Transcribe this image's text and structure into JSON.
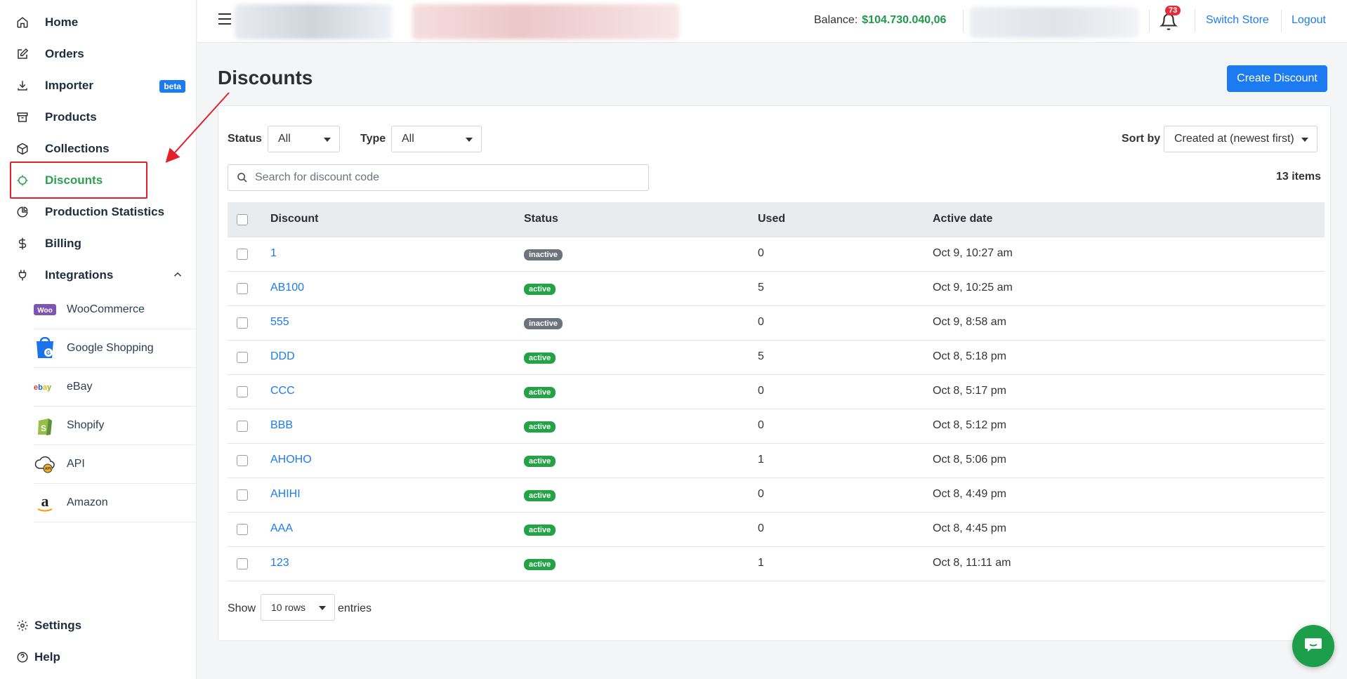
{
  "sidebar": {
    "items": [
      {
        "label": "Home",
        "icon": "home-icon"
      },
      {
        "label": "Orders",
        "icon": "edit-icon"
      },
      {
        "label": "Importer",
        "icon": "download-icon",
        "badge": "beta"
      },
      {
        "label": "Products",
        "icon": "archive-icon"
      },
      {
        "label": "Collections",
        "icon": "box-icon"
      },
      {
        "label": "Discounts",
        "icon": "crosshair-icon",
        "active": true
      },
      {
        "label": "Production Statistics",
        "icon": "pie-chart-icon"
      },
      {
        "label": "Billing",
        "icon": "dollar-icon"
      },
      {
        "label": "Integrations",
        "icon": "plug-icon",
        "expanded": true
      }
    ],
    "integrations": [
      {
        "label": "WooCommerce",
        "icon": "woocommerce-icon"
      },
      {
        "label": "Google Shopping",
        "icon": "google-shopping-icon"
      },
      {
        "label": "eBay",
        "icon": "ebay-icon"
      },
      {
        "label": "Shopify",
        "icon": "shopify-icon"
      },
      {
        "label": "API",
        "icon": "api-icon"
      },
      {
        "label": "Amazon",
        "icon": "amazon-icon"
      }
    ],
    "footer": [
      {
        "label": "Settings",
        "icon": "gear-icon"
      },
      {
        "label": "Help",
        "icon": "help-icon"
      }
    ]
  },
  "topbar": {
    "balance_label": "Balance:",
    "balance_value": "$104.730.040,06",
    "notifications_count": "73",
    "switch_store": "Switch Store",
    "logout": "Logout"
  },
  "page": {
    "title": "Discounts",
    "create_button": "Create Discount"
  },
  "filters": {
    "status_label": "Status",
    "status_value": "All",
    "type_label": "Type",
    "type_value": "All",
    "sort_label": "Sort by",
    "sort_value": "Created at (newest first)",
    "search_placeholder": "Search for discount code",
    "items_count": "13 items"
  },
  "table": {
    "columns": [
      "Discount",
      "Status",
      "Used",
      "Active date"
    ],
    "rows": [
      {
        "code": "1",
        "status": "inactive",
        "used": "0",
        "date": "Oct 9, 10:27 am"
      },
      {
        "code": "AB100",
        "status": "active",
        "used": "5",
        "date": "Oct 9, 10:25 am"
      },
      {
        "code": "555",
        "status": "inactive",
        "used": "0",
        "date": "Oct 9, 8:58 am"
      },
      {
        "code": "DDD",
        "status": "active",
        "used": "5",
        "date": "Oct 8, 5:18 pm"
      },
      {
        "code": "CCC",
        "status": "active",
        "used": "0",
        "date": "Oct 8, 5:17 pm"
      },
      {
        "code": "BBB",
        "status": "active",
        "used": "0",
        "date": "Oct 8, 5:12 pm"
      },
      {
        "code": "AHOHO",
        "status": "active",
        "used": "1",
        "date": "Oct 8, 5:06 pm"
      },
      {
        "code": "AHIHI",
        "status": "active",
        "used": "0",
        "date": "Oct 8, 4:49 pm"
      },
      {
        "code": "AAA",
        "status": "active",
        "used": "0",
        "date": "Oct 8, 4:45 pm"
      },
      {
        "code": "123",
        "status": "active",
        "used": "1",
        "date": "Oct 8, 11:11 am"
      }
    ]
  },
  "pagination": {
    "show_label": "Show",
    "rows_value": "10 rows",
    "entries_label": "entries"
  },
  "colors": {
    "primary": "#1d7bf2",
    "success": "#23a246",
    "active_nav": "#2e9e52",
    "annotation": "#e3202b"
  }
}
